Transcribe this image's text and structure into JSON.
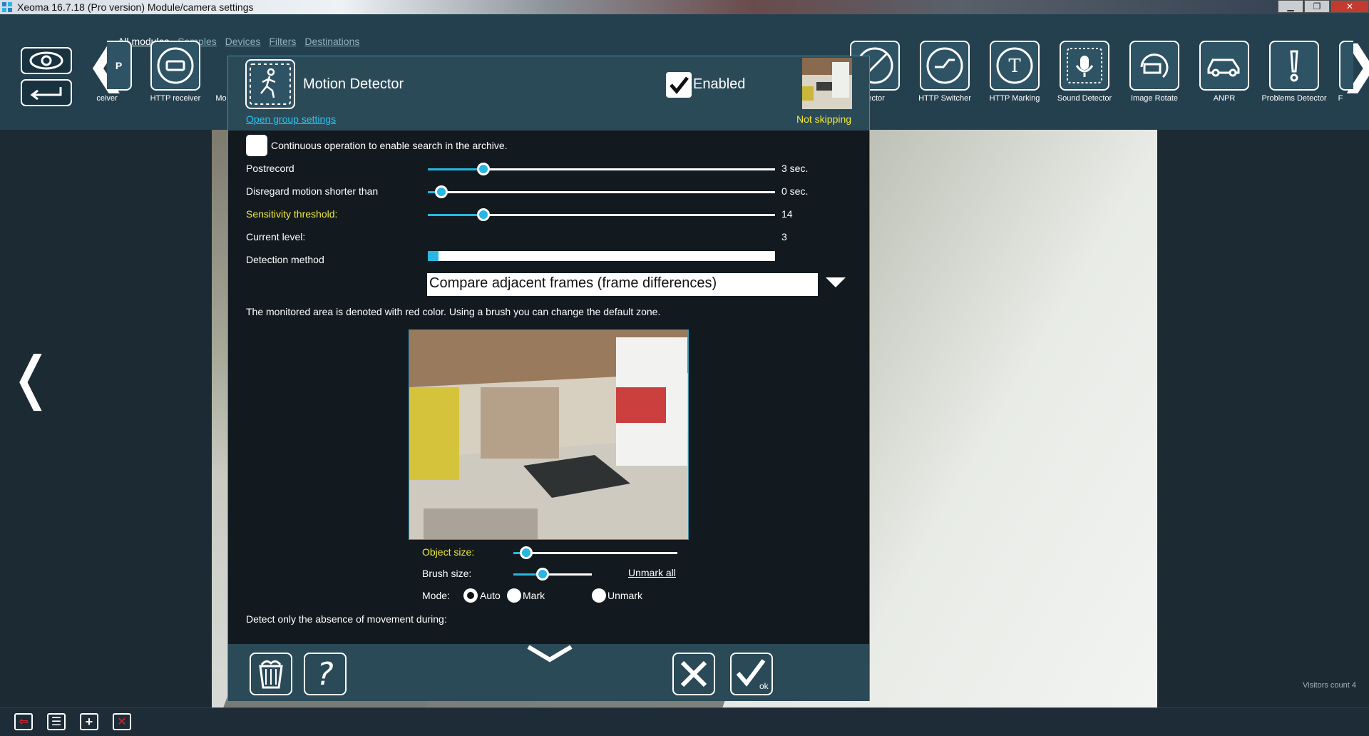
{
  "window": {
    "title": "Xeoma 16.7.18 (Pro version) Module/camera settings",
    "minimize": "▁",
    "maximize": "❐",
    "close": "✕"
  },
  "tabs": [
    "All modules",
    "Samples",
    "Devices",
    "Filters",
    "Destinations"
  ],
  "modules": [
    {
      "label": "ceiver",
      "icon": "http-receiver-partial-icon"
    },
    {
      "label": "HTTP receiver",
      "icon": "http-receiver-icon"
    },
    {
      "label": "Mo",
      "icon": "motion-partial-icon"
    },
    {
      "label": "Detector",
      "icon": "detector-icon"
    },
    {
      "label": "HTTP Switcher",
      "icon": "http-switcher-icon"
    },
    {
      "label": "HTTP Marking",
      "icon": "http-marking-icon"
    },
    {
      "label": "Sound Detector",
      "icon": "sound-detector-icon"
    },
    {
      "label": "Image Rotate",
      "icon": "image-rotate-icon"
    },
    {
      "label": "ANPR",
      "icon": "car-icon"
    },
    {
      "label": "Problems Detector",
      "icon": "exclamation-icon"
    },
    {
      "label": "F",
      "icon": "partial-icon"
    }
  ],
  "dialog": {
    "title": "Motion Detector",
    "group_link": "Open group settings",
    "enabled_label": "Enabled",
    "status": "Not skipping",
    "continuous_label": "Continuous operation to enable search in the archive.",
    "postrecord": {
      "label": "Postrecord",
      "value": "3 sec.",
      "fraction": 0.16
    },
    "disregard": {
      "label": "Disregard motion shorter than",
      "value": "0 sec.",
      "fraction": 0.04
    },
    "sensitivity": {
      "label": "Sensitivity threshold:",
      "value": "14",
      "fraction": 0.16
    },
    "current_level": {
      "label": "Current level:",
      "value": "3",
      "fraction": 0.03
    },
    "detection_method": {
      "label": "Detection method",
      "selected": "Compare adjacent frames (frame differences)"
    },
    "zone_hint": "The monitored area is denoted with red color. Using a brush you can change the default zone.",
    "object_size": {
      "label": "Object size:",
      "fraction": 0.08
    },
    "brush_size": {
      "label": "Brush size:",
      "fraction": 0.37
    },
    "unmark_all": "Unmark all",
    "mode": {
      "label": "Mode:",
      "options": [
        "Auto",
        "Mark",
        "Unmark"
      ],
      "selected": "Auto"
    },
    "absence_label": "Detect only the absence of movement during:"
  },
  "visitors": "Visitors count 4",
  "colors": {
    "accent": "#29b7e2",
    "highlight_text": "#f1ea3d",
    "panel": "#2b4a58",
    "dialog_bg": "#121a1f"
  }
}
